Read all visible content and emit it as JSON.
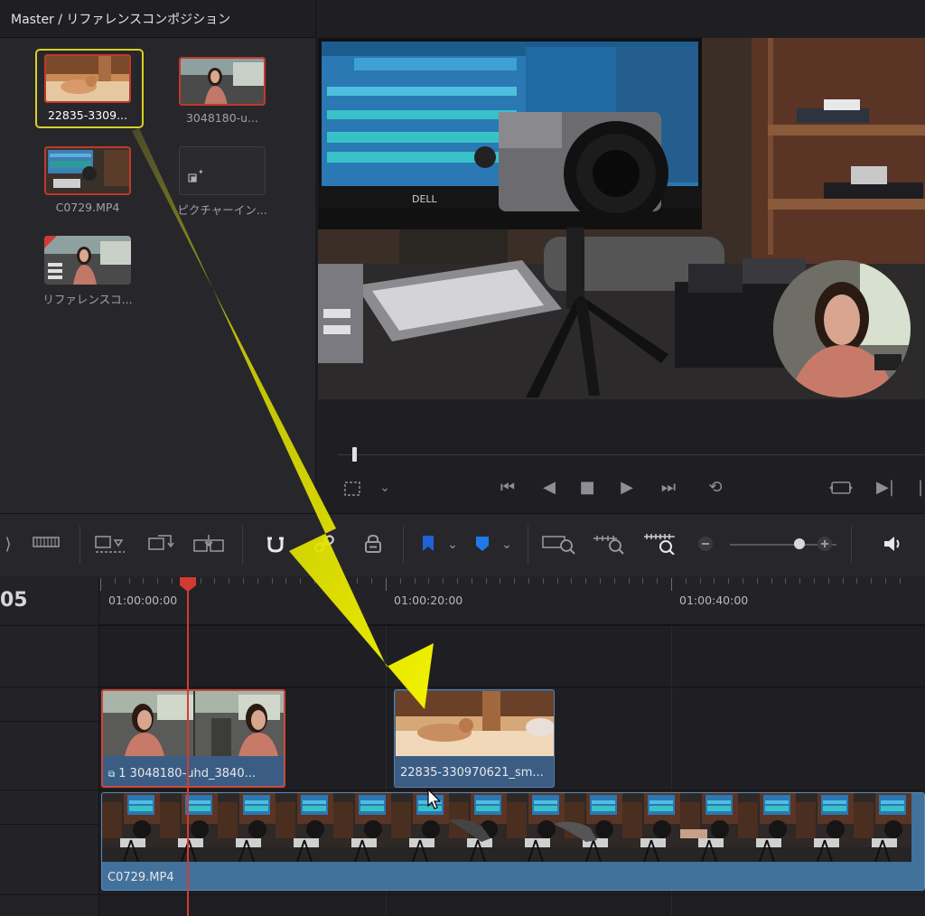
{
  "media_pool": {
    "breadcrumb": "Master / リファレンスコンポジション",
    "clips": [
      {
        "name": "22835-3309..."
      },
      {
        "name": "3048180-u..."
      },
      {
        "name": "C0729.MP4"
      },
      {
        "name": "ピクチャーイン..."
      },
      {
        "name": "リファレンスコ..."
      }
    ]
  },
  "viewer": {
    "transport_icons": [
      "skip-to-start-icon",
      "play-reverse-icon",
      "stop-icon",
      "play-icon",
      "skip-to-end-icon",
      "loop-icon"
    ]
  },
  "toolbar": {
    "icons": [
      "trim-icon",
      "overwrite-icon",
      "replace-icon",
      "place-on-top-icon",
      "snapping-icon",
      "linked-selection-icon",
      "position-lock-icon",
      "flag-icon",
      "marker-icon",
      "zoom-full-icon",
      "zoom-detail-icon",
      "zoom-custom-icon",
      "zoom-out-icon",
      "zoom-in-icon",
      "volume-icon"
    ],
    "flag_color": "#1f63d6",
    "marker_color": "#1f7ae8",
    "zoom_level": 0.65
  },
  "timeline": {
    "timecode_partial": "05",
    "ruler": [
      "01:00:00:00",
      "01:00:20:00",
      "01:00:40:00"
    ],
    "clips": {
      "pip": "1  3048180-uhd_3840...",
      "cat": "22835-330970621_sm...",
      "main": "C0729.MP4"
    },
    "playhead_color": "#d23b32"
  },
  "annotation": {
    "arrow_color": "#e6e600"
  }
}
